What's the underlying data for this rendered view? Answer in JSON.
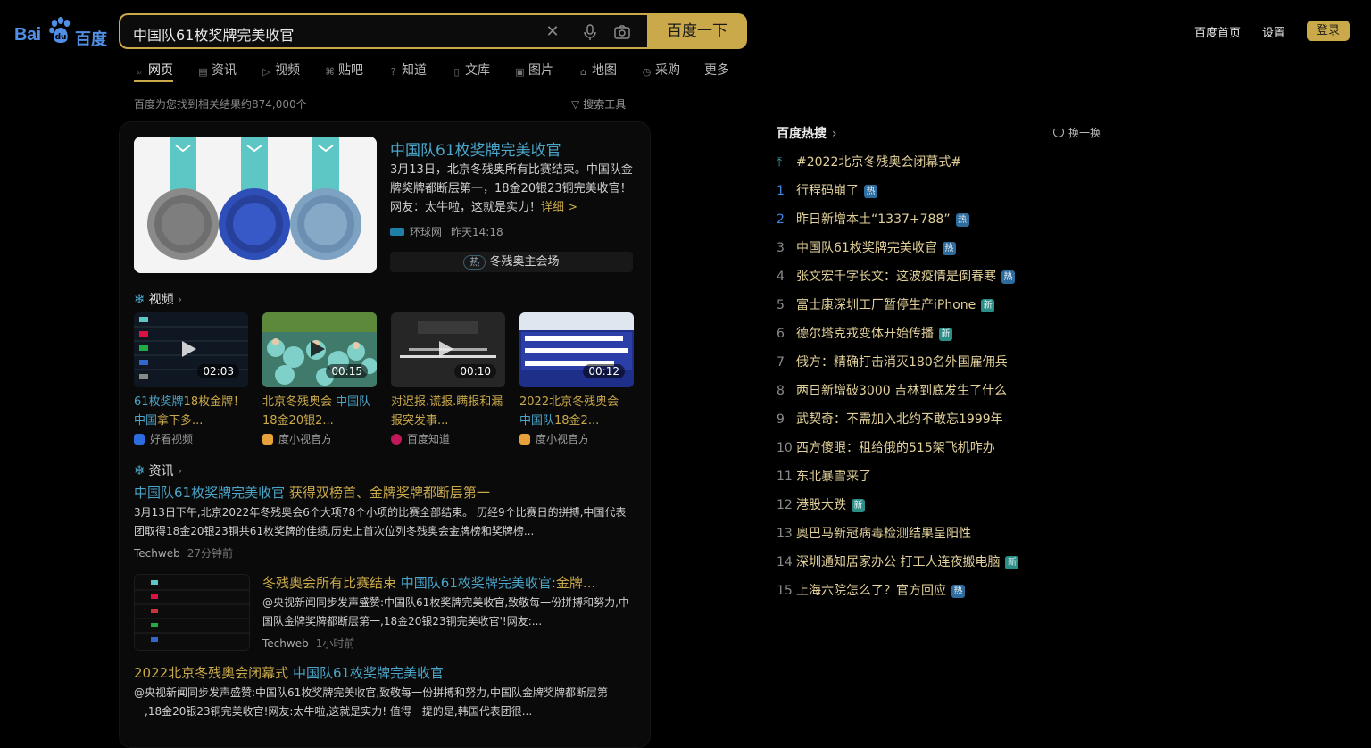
{
  "brand": {
    "logo_left": "Bai",
    "logo_right": "百度"
  },
  "search": {
    "query": "中国队61枚奖牌完美收官",
    "button": "百度一下"
  },
  "header_links": {
    "home": "百度首页",
    "settings": "设置",
    "login": "登录"
  },
  "tabs": [
    {
      "label": "网页",
      "icon": "search-icon"
    },
    {
      "label": "资讯",
      "icon": "news-icon"
    },
    {
      "label": "视频",
      "icon": "video-icon"
    },
    {
      "label": "贴吧",
      "icon": "tieba-icon"
    },
    {
      "label": "知道",
      "icon": "question-icon"
    },
    {
      "label": "文库",
      "icon": "doc-icon"
    },
    {
      "label": "图片",
      "icon": "image-icon"
    },
    {
      "label": "地图",
      "icon": "map-icon"
    },
    {
      "label": "采购",
      "icon": "cart-icon"
    },
    {
      "label": "更多",
      "icon": ""
    }
  ],
  "result_count": "百度为您找到相关结果约874,000个",
  "search_tools": "搜索工具",
  "main_result": {
    "title": "中国队61枚奖牌完美收官",
    "desc": "3月13日，北京冬残奥所有比赛结束。中国队金牌奖牌都断层第一，18金20银23铜完美收官！网友：太牛啦，这就是实力！",
    "more": "详细 >",
    "source": "环球网",
    "time": "昨天14:18",
    "hot_tag": "热",
    "hot_link": "冬残奥主会场"
  },
  "video_section": {
    "title": "视频",
    "items": [
      {
        "duration": "02:03",
        "title_pre": "",
        "title_hl": "61枚奖牌",
        "title_post": "18枚金牌！",
        "title_hl2": "中国",
        "title_post2": "拿下多...",
        "source": "好看视频"
      },
      {
        "duration": "00:15",
        "title_pre": "北京冬残奥会 ",
        "title_hl": "中国队",
        "title_post": "18金20银2...",
        "title_hl2": "",
        "title_post2": "",
        "source": "度小视官方"
      },
      {
        "duration": "00:10",
        "title_pre": "对迟报.谎报.瞒报和漏报突发事...",
        "title_hl": "",
        "title_post": "",
        "title_hl2": "",
        "title_post2": "",
        "source": "百度知道"
      },
      {
        "duration": "00:12",
        "title_pre": "2022北京冬残奥会 ",
        "title_hl": "中国队",
        "title_post": "18金2...",
        "title_hl2": "",
        "title_post2": "",
        "source": "度小视官方"
      }
    ]
  },
  "news_section": {
    "title": "资讯",
    "items": [
      {
        "title_hl": "中国队61枚奖牌完美收官",
        "title_post": " 获得双榜首、金牌奖牌都断层第一",
        "desc": "3月13日下午,北京2022年冬残奥会6个大项78个小项的比赛全部结束。 历经9个比赛日的拼搏,中国代表团取得18金20银23铜共61枚奖牌的佳绩,历史上首次位列冬残奥会金牌榜和奖牌榜...",
        "source": "Techweb",
        "time": "27分钟前"
      },
      {
        "title_pre": "冬残奥会所有比赛结束 ",
        "title_hl": "中国队61枚奖牌完美收官",
        "title_post": ":金牌...",
        "desc": "@央视新闻同步发声盛赞:中国队61枚奖牌完美收官,致敬每一份拼搏和努力,中国队金牌奖牌都断层第一,18金20银23铜完美收官'!网友:...",
        "source": "Techweb",
        "time": "1小时前"
      },
      {
        "title_pre": "2022北京冬残奥会闭幕式 ",
        "title_hl": "中国队61枚奖牌完美收官",
        "desc": "@央视新闻同步发声盛赞:中国队61枚奖牌完美收官,致敬每一份拼搏和努力,中国队金牌奖牌都断层第一,18金20银23铜完美收官!网友:太牛啦,这就是实力! 值得一提的是,韩国代表团很..."
      }
    ]
  },
  "hot_list": {
    "title": "百度热搜",
    "refresh": "换一换",
    "pinned": "#2022北京冬残奥会闭幕式#",
    "items": [
      {
        "rank": "1",
        "text": "行程码崩了",
        "badge": "热"
      },
      {
        "rank": "2",
        "text": "昨日新增本土“1337+788”",
        "badge": "热"
      },
      {
        "rank": "3",
        "text": "中国队61枚奖牌完美收官",
        "badge": "热"
      },
      {
        "rank": "4",
        "text": "张文宏千字长文：这波疫情是倒春寒",
        "badge": "热"
      },
      {
        "rank": "5",
        "text": "富士康深圳工厂暂停生产iPhone",
        "badge": "新"
      },
      {
        "rank": "6",
        "text": "德尔塔克戎变体开始传播",
        "badge": "新"
      },
      {
        "rank": "7",
        "text": "俄方：精确打击消灭180名外国雇佣兵",
        "badge": ""
      },
      {
        "rank": "8",
        "text": "两日新增破3000 吉林到底发生了什么",
        "badge": ""
      },
      {
        "rank": "9",
        "text": "武契奇：不需加入北约不敢忘1999年",
        "badge": ""
      },
      {
        "rank": "10",
        "text": "西方傻眼：租给俄的515架飞机咋办",
        "badge": ""
      },
      {
        "rank": "11",
        "text": "东北暴雪来了",
        "badge": ""
      },
      {
        "rank": "12",
        "text": "港股大跌",
        "badge": "新"
      },
      {
        "rank": "13",
        "text": "奥巴马新冠病毒检测结果呈阳性",
        "badge": ""
      },
      {
        "rank": "14",
        "text": "深圳通知居家办公 打工人连夜搬电脑",
        "badge": "新"
      },
      {
        "rank": "15",
        "text": "上海六院怎么了？官方回应",
        "badge": "热"
      }
    ]
  },
  "colors": {
    "accent_gold": "#c9a94a",
    "link_blue": "#4aa5c9",
    "hot_badge": "#2f6c9e",
    "new_badge": "#2b8f87"
  }
}
